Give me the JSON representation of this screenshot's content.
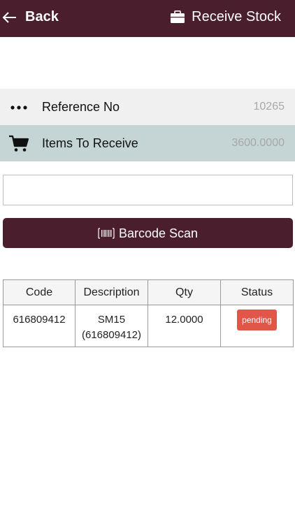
{
  "header": {
    "back_label": "Back",
    "title": "Receive Stock",
    "background_color": "#4a1e2d",
    "back_icon": "arrow-left-icon",
    "title_icon": "briefcase-icon"
  },
  "info": {
    "reference": {
      "label": "Reference No",
      "value": "10265",
      "icon": "more-dots-icon"
    },
    "items_to_receive": {
      "label": "Items To Receive",
      "value": "3600.0000",
      "icon": "cart-icon"
    }
  },
  "scan": {
    "input_value": "",
    "button_label": "Barcode Scan",
    "button_icon": "barcode-icon"
  },
  "table": {
    "headers": {
      "code": "Code",
      "description": "Description",
      "qty": "Qty",
      "status": "Status"
    },
    "rows": [
      {
        "code": "616809412",
        "description_line1": "SM15",
        "description_line2": "(616809412)",
        "qty": "12.0000",
        "status": "pending"
      }
    ],
    "status_color": "#e0574a"
  }
}
